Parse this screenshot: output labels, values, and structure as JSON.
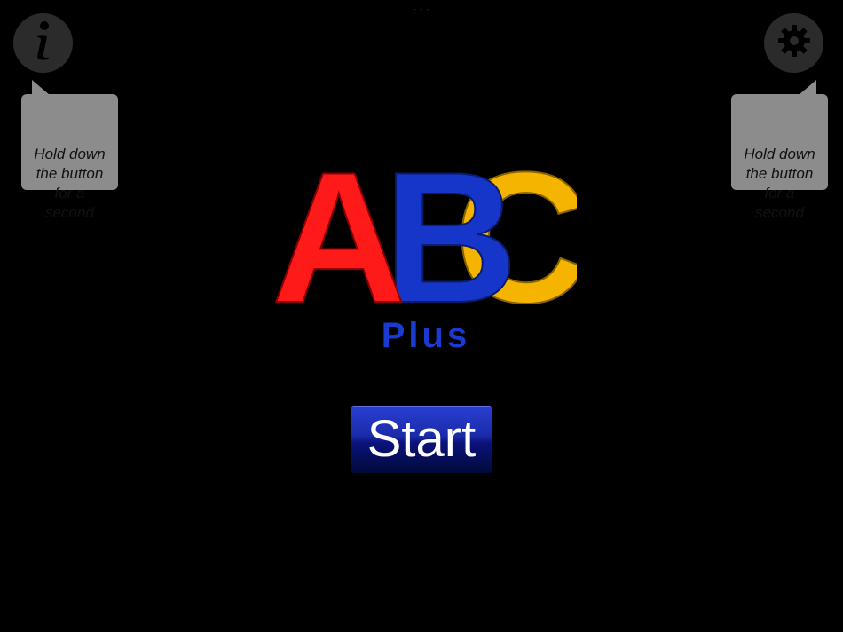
{
  "status_bar": {
    "indicator": "- - -"
  },
  "info_button": {
    "icon": "info-icon",
    "tooltip": "Hold down\nthe button\nfor a\nsecond"
  },
  "settings_button": {
    "icon": "gear-icon",
    "tooltip": "Hold down\nthe button\nfor a\nsecond"
  },
  "logo": {
    "letters": [
      {
        "char": "A",
        "color": "#ff1a1a"
      },
      {
        "char": "B",
        "color": "#1536c8"
      },
      {
        "char": "C",
        "color": "#f5b400"
      }
    ],
    "subtitle": "Plus",
    "subtitle_color": "#1a3ad0"
  },
  "start_button": {
    "label": "Start"
  }
}
